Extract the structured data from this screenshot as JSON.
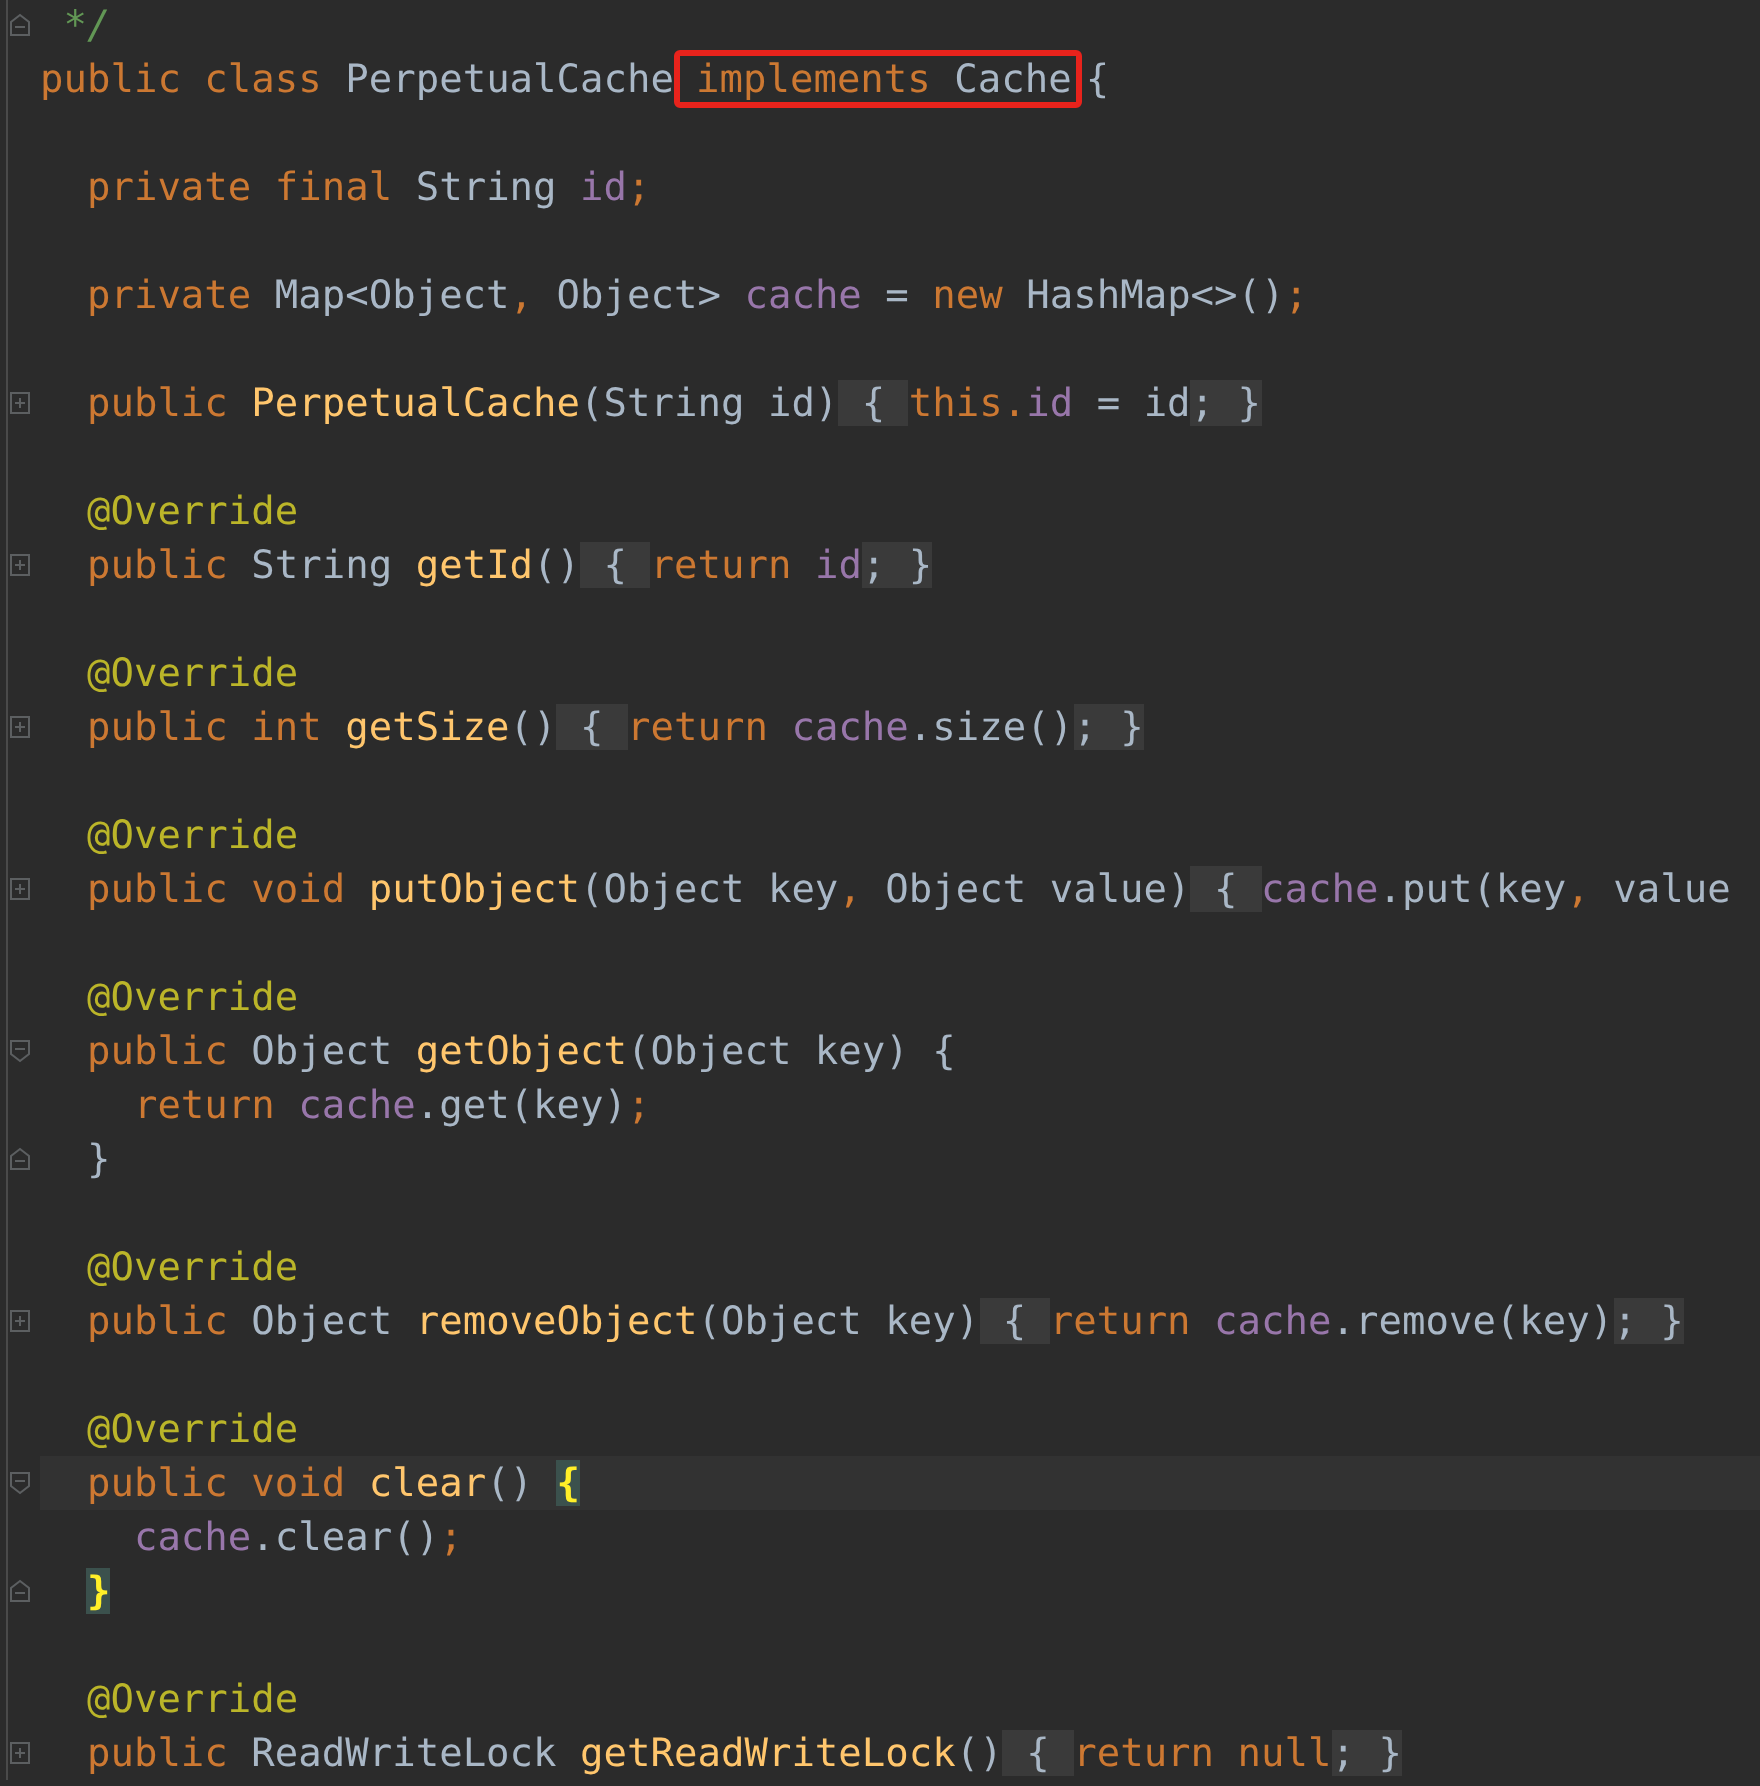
{
  "editor": {
    "lines": [
      {
        "kind": "code",
        "gutter_icon": {
          "kind": "end"
        },
        "tokens": [
          {
            "kind": "comment",
            "text": "*/"
          }
        ]
      },
      {
        "kind": "code",
        "tokens": [
          {
            "kind": "kw",
            "text": "public class "
          },
          {
            "kind": "plain",
            "text": "PerpetualCache"
          },
          {
            "kind": "boxed",
            "tokens": [
              {
                "kind": "kw",
                "text": "implements "
              },
              {
                "kind": "plain",
                "text": "Cache"
              }
            ]
          },
          {
            "kind": "plain",
            "text": "{"
          }
        ],
        "children": [
          {
            "kind": "blank"
          },
          {
            "kind": "code",
            "tokens": [
              {
                "kind": "kw",
                "text": "private final "
              },
              {
                "kind": "plain",
                "text": "String "
              },
              {
                "kind": "field",
                "text": "id"
              },
              {
                "kind": "kw",
                "text": ";"
              }
            ]
          },
          {
            "kind": "blank"
          },
          {
            "kind": "code",
            "tokens": [
              {
                "kind": "kw",
                "text": "private "
              },
              {
                "kind": "plain",
                "text": "Map<Object"
              },
              {
                "kind": "kw",
                "text": ","
              },
              {
                "kind": "plain",
                "text": " Object> "
              },
              {
                "kind": "field",
                "text": "cache"
              },
              {
                "kind": "plain",
                "text": " = "
              },
              {
                "kind": "kw",
                "text": "new "
              },
              {
                "kind": "plain",
                "text": "HashMap<>()"
              },
              {
                "kind": "kw",
                "text": ";"
              }
            ]
          },
          {
            "kind": "blank"
          },
          {
            "kind": "code",
            "gutter_icon": {
              "kind": "collapsed"
            },
            "tokens": [
              {
                "kind": "kw",
                "text": "public "
              },
              {
                "kind": "method",
                "text": "PerpetualCache"
              },
              {
                "kind": "plain",
                "text": "(String id)"
              },
              {
                "kind": "fold",
                "text": " { "
              },
              {
                "kind": "kw",
                "text": "this."
              },
              {
                "kind": "field",
                "text": "id"
              },
              {
                "kind": "plain",
                "text": " = id"
              },
              {
                "kind": "fold",
                "text": "; }"
              }
            ]
          },
          {
            "kind": "blank"
          },
          {
            "kind": "code",
            "tokens": [
              {
                "kind": "annot",
                "text": "@Override"
              }
            ]
          },
          {
            "kind": "code",
            "gutter_icon": {
              "kind": "collapsed"
            },
            "tokens": [
              {
                "kind": "kw",
                "text": "public "
              },
              {
                "kind": "plain",
                "text": "String "
              },
              {
                "kind": "method",
                "text": "getId"
              },
              {
                "kind": "plain",
                "text": "()"
              },
              {
                "kind": "fold",
                "text": " { "
              },
              {
                "kind": "kw",
                "text": "return "
              },
              {
                "kind": "field",
                "text": "id"
              },
              {
                "kind": "fold",
                "text": "; }"
              }
            ]
          },
          {
            "kind": "blank"
          },
          {
            "kind": "code",
            "tokens": [
              {
                "kind": "annot",
                "text": "@Override"
              }
            ]
          },
          {
            "kind": "code",
            "gutter_icon": {
              "kind": "collapsed"
            },
            "tokens": [
              {
                "kind": "kw",
                "text": "public int "
              },
              {
                "kind": "method",
                "text": "getSize"
              },
              {
                "kind": "plain",
                "text": "()"
              },
              {
                "kind": "fold",
                "text": " { "
              },
              {
                "kind": "kw",
                "text": "return "
              },
              {
                "kind": "field",
                "text": "cache"
              },
              {
                "kind": "plain",
                "text": ".size()"
              },
              {
                "kind": "fold",
                "text": "; }"
              }
            ]
          },
          {
            "kind": "blank"
          },
          {
            "kind": "code",
            "tokens": [
              {
                "kind": "annot",
                "text": "@Override"
              }
            ]
          },
          {
            "kind": "code",
            "gutter_icon": {
              "kind": "collapsed"
            },
            "tokens": [
              {
                "kind": "kw",
                "text": "public void "
              },
              {
                "kind": "method",
                "text": "putObject"
              },
              {
                "kind": "plain",
                "text": "(Object key"
              },
              {
                "kind": "kw",
                "text": ","
              },
              {
                "kind": "plain",
                "text": " Object value)"
              },
              {
                "kind": "fold",
                "text": " { "
              },
              {
                "kind": "field",
                "text": "cache"
              },
              {
                "kind": "plain",
                "text": ".put(key"
              },
              {
                "kind": "kw",
                "text": ","
              },
              {
                "kind": "plain",
                "text": " value"
              }
            ]
          },
          {
            "kind": "blank"
          },
          {
            "kind": "code",
            "tokens": [
              {
                "kind": "annot",
                "text": "@Override"
              }
            ]
          },
          {
            "kind": "code",
            "gutter_icon": {
              "kind": "start"
            },
            "tokens": [
              {
                "kind": "kw",
                "text": "public "
              },
              {
                "kind": "plain",
                "text": "Object "
              },
              {
                "kind": "method",
                "text": "getObject"
              },
              {
                "kind": "plain",
                "text": "(Object key) {"
              }
            ],
            "children": [
              {
                "kind": "code",
                "tokens": [
                  {
                    "kind": "kw",
                    "text": "return "
                  },
                  {
                    "kind": "field",
                    "text": "cache"
                  },
                  {
                    "kind": "plain",
                    "text": ".get(key)"
                  },
                  {
                    "kind": "kw",
                    "text": ";"
                  }
                ]
              }
            ]
          },
          {
            "kind": "code",
            "gutter_icon": {
              "kind": "end"
            },
            "tokens": [
              {
                "kind": "plain",
                "text": "}"
              }
            ]
          },
          {
            "kind": "blank"
          },
          {
            "kind": "code",
            "tokens": [
              {
                "kind": "annot",
                "text": "@Override"
              }
            ]
          },
          {
            "kind": "code",
            "gutter_icon": {
              "kind": "collapsed"
            },
            "tokens": [
              {
                "kind": "kw",
                "text": "public "
              },
              {
                "kind": "plain",
                "text": "Object "
              },
              {
                "kind": "method",
                "text": "removeObject"
              },
              {
                "kind": "plain",
                "text": "(Object key)"
              },
              {
                "kind": "fold",
                "text": " { "
              },
              {
                "kind": "kw",
                "text": "return "
              },
              {
                "kind": "field",
                "text": "cache"
              },
              {
                "kind": "plain",
                "text": ".remove(key)"
              },
              {
                "kind": "fold",
                "text": "; }"
              }
            ]
          },
          {
            "kind": "blank"
          },
          {
            "kind": "code",
            "tokens": [
              {
                "kind": "annot",
                "text": "@Override"
              }
            ]
          },
          {
            "kind": "code",
            "current": true,
            "gutter_icon": {
              "kind": "start"
            },
            "tokens": [
              {
                "kind": "kw",
                "text": "public void "
              },
              {
                "kind": "method",
                "text": "clear"
              },
              {
                "kind": "plain",
                "text": "() "
              },
              {
                "kind": "match",
                "text": "{"
              }
            ],
            "children": [
              {
                "kind": "code",
                "tokens": [
                  {
                    "kind": "field",
                    "text": "cache"
                  },
                  {
                    "kind": "plain",
                    "text": ".clear()"
                  },
                  {
                    "kind": "kw",
                    "text": ";"
                  }
                ]
              }
            ]
          },
          {
            "kind": "code",
            "gutter_icon": {
              "kind": "end"
            },
            "tokens": [
              {
                "kind": "match",
                "text": "}"
              }
            ]
          },
          {
            "kind": "blank"
          },
          {
            "kind": "code",
            "tokens": [
              {
                "kind": "annot",
                "text": "@Override"
              }
            ]
          },
          {
            "kind": "code",
            "gutter_icon": {
              "kind": "collapsed"
            },
            "tokens": [
              {
                "kind": "kw",
                "text": "public "
              },
              {
                "kind": "plain",
                "text": "ReadWriteLock "
              },
              {
                "kind": "method",
                "text": "getReadWriteLock"
              },
              {
                "kind": "plain",
                "text": "()"
              },
              {
                "kind": "fold",
                "text": " { "
              },
              {
                "kind": "kw",
                "text": "return null"
              },
              {
                "kind": "fold",
                "text": "; }"
              }
            ]
          }
        ]
      }
    ]
  }
}
